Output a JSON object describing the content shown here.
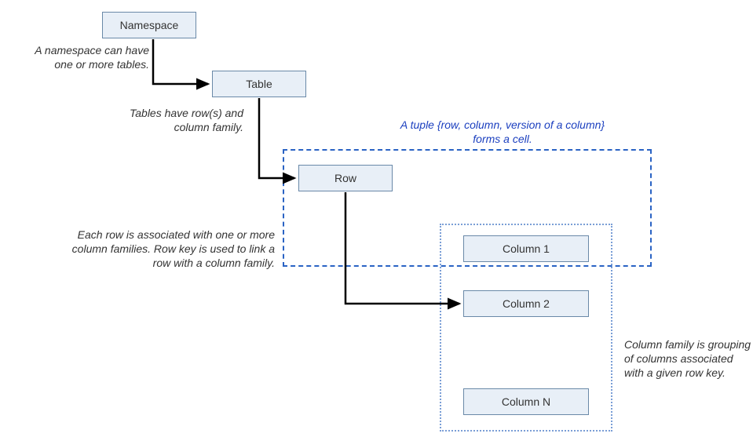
{
  "nodes": {
    "namespace": "Namespace",
    "table": "Table",
    "row": "Row",
    "column1": "Column 1",
    "column2": "Column 2",
    "columnN": "Column N"
  },
  "annotations": {
    "ns_desc": "A namespace can have one or more tables.",
    "table_desc": "Tables have row(s) and column family.",
    "row_desc": "Each row is associated with one or more column families. Row key is used to link a row with a column family.",
    "tuple_desc": "A tuple {row, column, version of a column} forms a cell.",
    "family_desc": "Column family is grouping of columns associated with a given row key."
  }
}
